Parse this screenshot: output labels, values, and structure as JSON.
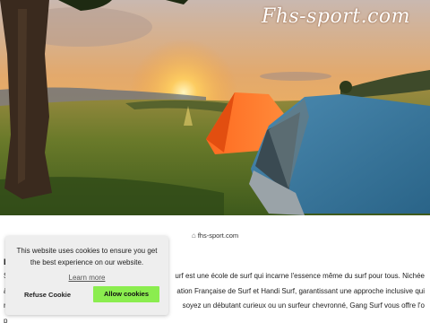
{
  "hero": {
    "logo_text": "Fhs-sport.com"
  },
  "domain_link": {
    "icon": "home-icon",
    "label": "fhs-sport.com"
  },
  "article": {
    "heading_initial": "L",
    "line1_start": "S",
    "line1_text": "urf est une école de surf qui incarne l'essence même du surf pour tous. Nichée",
    "line2_start": "à",
    "line2_text": "ation Française de Surf et Handi Surf, garantissant une approche inclusive qui",
    "line3_start": "r",
    "line3_text": "soyez un débutant curieux ou un surfeur chevronné, Gang Surf vous offre l'o",
    "line4_start": "p"
  },
  "cookie_banner": {
    "message": "This website uses cookies to ensure you get the best experience on our website.",
    "learn_more": "Learn more",
    "refuse_label": "Refuse Cookie",
    "allow_label": "Allow cookies",
    "allow_color": "#8bed4f",
    "background": "#eeeeee"
  }
}
